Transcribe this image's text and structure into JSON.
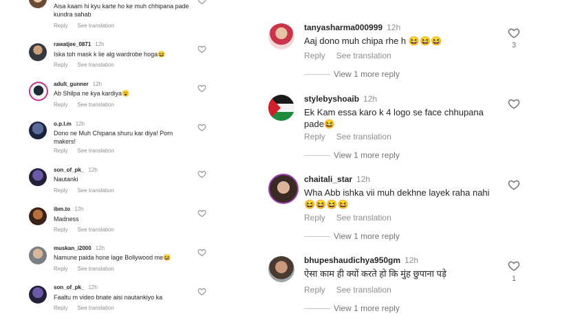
{
  "left_comments": [
    {
      "username": "",
      "time": "",
      "text": "Aisa kaam hi kyu karte ho ke muh chhipana pade kundra sahab",
      "reply": "Reply",
      "see_translation": "See translation"
    },
    {
      "username": "rawatjee_0871",
      "time": "12h",
      "text": "Iska toh mask k lie alg wardrobe hoga😆",
      "reply": "Reply",
      "see_translation": "See translation"
    },
    {
      "username": "adult_gunner",
      "time": "12h",
      "text": "Ab Shilpa ne kya kardiya😮",
      "reply": "Reply",
      "see_translation": "See translation"
    },
    {
      "username": "o.p.l.m",
      "time": "12h",
      "text": "Dono ne Muh Chipana shuru kar diya! Porn makers!",
      "reply": "Reply",
      "see_translation": "See translation"
    },
    {
      "username": "son_of_pk_",
      "time": "12h",
      "text": "Nautanki",
      "reply": "Reply",
      "see_translation": "See translation"
    },
    {
      "username": "ibm.to",
      "time": "12h",
      "text": "Madness",
      "reply": "Reply",
      "see_translation": "See translation"
    },
    {
      "username": "muskan_i2000",
      "time": "12h",
      "text": "Namune paida hone lage Bollywood me😆",
      "reply": "Reply",
      "see_translation": "See translation"
    },
    {
      "username": "son_of_pk_",
      "time": "12h",
      "text": "Faaltu m video bnate aisi nautankiyo ka",
      "reply": "Reply",
      "see_translation": "See translation"
    }
  ],
  "right_comments": [
    {
      "username": "tanyasharma000999",
      "time": "12h",
      "text": "Aaj dono muh chipa rhe h 😆😆😆",
      "reply": "Reply",
      "see_translation": "See translation",
      "likes": "3",
      "view_replies": "View 1 more reply"
    },
    {
      "username": "stylebyshoaib",
      "time": "12h",
      "text": "Ek Kam essa karo k 4 logo se face chhupana pade😆",
      "reply": "Reply",
      "see_translation": "See translation",
      "likes": "",
      "view_replies": "View 1 more reply"
    },
    {
      "username": "chaitali_star",
      "time": "12h",
      "text": "Wha Abb ishka vii muh dekhne layek raha nahi 😆😆😆😆",
      "reply": "Reply",
      "see_translation": "See translation",
      "likes": "",
      "view_replies": "View 1 more reply"
    },
    {
      "username": "bhupeshaudichya950gm",
      "time": "12h",
      "text": "ऐसा काम ही क्यों करते हो कि मुंह छुपाना पड़े",
      "reply": "Reply",
      "see_translation": "See translation",
      "likes": "1",
      "view_replies": "View 1 more reply"
    }
  ],
  "icons": {
    "like": "heart-outline-icon",
    "avatar": "profile-avatar"
  },
  "colors": {
    "text": "#262626",
    "secondary": "#8e8e8e",
    "divider": "#c7c7c7",
    "background": "#ffffff"
  }
}
